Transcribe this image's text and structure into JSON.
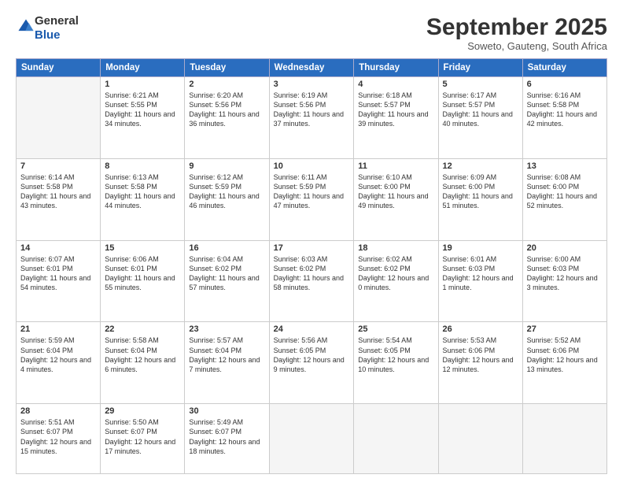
{
  "header": {
    "logo_line1": "General",
    "logo_line2": "Blue",
    "month": "September 2025",
    "location": "Soweto, Gauteng, South Africa"
  },
  "days_of_week": [
    "Sunday",
    "Monday",
    "Tuesday",
    "Wednesday",
    "Thursday",
    "Friday",
    "Saturday"
  ],
  "weeks": [
    [
      {
        "day": "",
        "sunrise": "",
        "sunset": "",
        "daylight": ""
      },
      {
        "day": "1",
        "sunrise": "Sunrise: 6:21 AM",
        "sunset": "Sunset: 5:55 PM",
        "daylight": "Daylight: 11 hours and 34 minutes."
      },
      {
        "day": "2",
        "sunrise": "Sunrise: 6:20 AM",
        "sunset": "Sunset: 5:56 PM",
        "daylight": "Daylight: 11 hours and 36 minutes."
      },
      {
        "day": "3",
        "sunrise": "Sunrise: 6:19 AM",
        "sunset": "Sunset: 5:56 PM",
        "daylight": "Daylight: 11 hours and 37 minutes."
      },
      {
        "day": "4",
        "sunrise": "Sunrise: 6:18 AM",
        "sunset": "Sunset: 5:57 PM",
        "daylight": "Daylight: 11 hours and 39 minutes."
      },
      {
        "day": "5",
        "sunrise": "Sunrise: 6:17 AM",
        "sunset": "Sunset: 5:57 PM",
        "daylight": "Daylight: 11 hours and 40 minutes."
      },
      {
        "day": "6",
        "sunrise": "Sunrise: 6:16 AM",
        "sunset": "Sunset: 5:58 PM",
        "daylight": "Daylight: 11 hours and 42 minutes."
      }
    ],
    [
      {
        "day": "7",
        "sunrise": "Sunrise: 6:14 AM",
        "sunset": "Sunset: 5:58 PM",
        "daylight": "Daylight: 11 hours and 43 minutes."
      },
      {
        "day": "8",
        "sunrise": "Sunrise: 6:13 AM",
        "sunset": "Sunset: 5:58 PM",
        "daylight": "Daylight: 11 hours and 44 minutes."
      },
      {
        "day": "9",
        "sunrise": "Sunrise: 6:12 AM",
        "sunset": "Sunset: 5:59 PM",
        "daylight": "Daylight: 11 hours and 46 minutes."
      },
      {
        "day": "10",
        "sunrise": "Sunrise: 6:11 AM",
        "sunset": "Sunset: 5:59 PM",
        "daylight": "Daylight: 11 hours and 47 minutes."
      },
      {
        "day": "11",
        "sunrise": "Sunrise: 6:10 AM",
        "sunset": "Sunset: 6:00 PM",
        "daylight": "Daylight: 11 hours and 49 minutes."
      },
      {
        "day": "12",
        "sunrise": "Sunrise: 6:09 AM",
        "sunset": "Sunset: 6:00 PM",
        "daylight": "Daylight: 11 hours and 51 minutes."
      },
      {
        "day": "13",
        "sunrise": "Sunrise: 6:08 AM",
        "sunset": "Sunset: 6:00 PM",
        "daylight": "Daylight: 11 hours and 52 minutes."
      }
    ],
    [
      {
        "day": "14",
        "sunrise": "Sunrise: 6:07 AM",
        "sunset": "Sunset: 6:01 PM",
        "daylight": "Daylight: 11 hours and 54 minutes."
      },
      {
        "day": "15",
        "sunrise": "Sunrise: 6:06 AM",
        "sunset": "Sunset: 6:01 PM",
        "daylight": "Daylight: 11 hours and 55 minutes."
      },
      {
        "day": "16",
        "sunrise": "Sunrise: 6:04 AM",
        "sunset": "Sunset: 6:02 PM",
        "daylight": "Daylight: 11 hours and 57 minutes."
      },
      {
        "day": "17",
        "sunrise": "Sunrise: 6:03 AM",
        "sunset": "Sunset: 6:02 PM",
        "daylight": "Daylight: 11 hours and 58 minutes."
      },
      {
        "day": "18",
        "sunrise": "Sunrise: 6:02 AM",
        "sunset": "Sunset: 6:02 PM",
        "daylight": "Daylight: 12 hours and 0 minutes."
      },
      {
        "day": "19",
        "sunrise": "Sunrise: 6:01 AM",
        "sunset": "Sunset: 6:03 PM",
        "daylight": "Daylight: 12 hours and 1 minute."
      },
      {
        "day": "20",
        "sunrise": "Sunrise: 6:00 AM",
        "sunset": "Sunset: 6:03 PM",
        "daylight": "Daylight: 12 hours and 3 minutes."
      }
    ],
    [
      {
        "day": "21",
        "sunrise": "Sunrise: 5:59 AM",
        "sunset": "Sunset: 6:04 PM",
        "daylight": "Daylight: 12 hours and 4 minutes."
      },
      {
        "day": "22",
        "sunrise": "Sunrise: 5:58 AM",
        "sunset": "Sunset: 6:04 PM",
        "daylight": "Daylight: 12 hours and 6 minutes."
      },
      {
        "day": "23",
        "sunrise": "Sunrise: 5:57 AM",
        "sunset": "Sunset: 6:04 PM",
        "daylight": "Daylight: 12 hours and 7 minutes."
      },
      {
        "day": "24",
        "sunrise": "Sunrise: 5:56 AM",
        "sunset": "Sunset: 6:05 PM",
        "daylight": "Daylight: 12 hours and 9 minutes."
      },
      {
        "day": "25",
        "sunrise": "Sunrise: 5:54 AM",
        "sunset": "Sunset: 6:05 PM",
        "daylight": "Daylight: 12 hours and 10 minutes."
      },
      {
        "day": "26",
        "sunrise": "Sunrise: 5:53 AM",
        "sunset": "Sunset: 6:06 PM",
        "daylight": "Daylight: 12 hours and 12 minutes."
      },
      {
        "day": "27",
        "sunrise": "Sunrise: 5:52 AM",
        "sunset": "Sunset: 6:06 PM",
        "daylight": "Daylight: 12 hours and 13 minutes."
      }
    ],
    [
      {
        "day": "28",
        "sunrise": "Sunrise: 5:51 AM",
        "sunset": "Sunset: 6:07 PM",
        "daylight": "Daylight: 12 hours and 15 minutes."
      },
      {
        "day": "29",
        "sunrise": "Sunrise: 5:50 AM",
        "sunset": "Sunset: 6:07 PM",
        "daylight": "Daylight: 12 hours and 17 minutes."
      },
      {
        "day": "30",
        "sunrise": "Sunrise: 5:49 AM",
        "sunset": "Sunset: 6:07 PM",
        "daylight": "Daylight: 12 hours and 18 minutes."
      },
      {
        "day": "",
        "sunrise": "",
        "sunset": "",
        "daylight": ""
      },
      {
        "day": "",
        "sunrise": "",
        "sunset": "",
        "daylight": ""
      },
      {
        "day": "",
        "sunrise": "",
        "sunset": "",
        "daylight": ""
      },
      {
        "day": "",
        "sunrise": "",
        "sunset": "",
        "daylight": ""
      }
    ]
  ]
}
